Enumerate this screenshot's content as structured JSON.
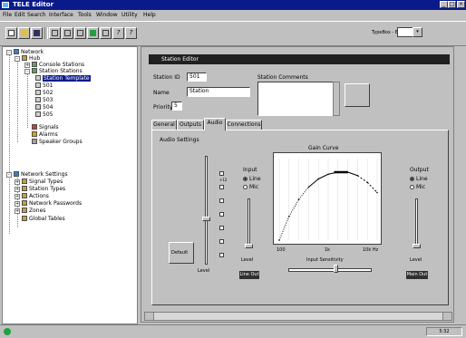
{
  "window": {
    "title": "TELE Editor"
  },
  "menu": [
    "File",
    "Edit",
    "Search",
    "Interface",
    "Tools",
    "Window",
    "Utility",
    "Help"
  ],
  "toolbar": {
    "type_label": "TypeBox - EE",
    "buttons": [
      "new",
      "open",
      "save",
      "cut",
      "copy",
      "paste",
      "props",
      "settings",
      "help",
      "info"
    ]
  },
  "tree": {
    "items": [
      {
        "label": "Network",
        "level": 0
      },
      {
        "label": "Hub",
        "level": 1
      },
      {
        "label": "Console Stations",
        "level": 2
      },
      {
        "label": "Station Stations",
        "level": 2
      },
      {
        "label": "Station Template",
        "level": 3,
        "selected": true
      },
      {
        "label": "501",
        "level": 3
      },
      {
        "label": "502",
        "level": 3
      },
      {
        "label": "503",
        "level": 3
      },
      {
        "label": "504",
        "level": 3
      },
      {
        "label": "505",
        "level": 3
      },
      {
        "label": "Signals",
        "level": 2
      },
      {
        "label": "Alarms",
        "level": 2
      },
      {
        "label": "Speaker Groups",
        "level": 2
      },
      {
        "label": "Network Settings",
        "level": 1
      },
      {
        "label": "Signal Types",
        "level": 2
      },
      {
        "label": "Station Types",
        "level": 2
      },
      {
        "label": "Actions",
        "level": 2
      },
      {
        "label": "Network Passwords",
        "level": 2
      },
      {
        "label": "Zones",
        "level": 2
      },
      {
        "label": "Global Tables",
        "level": 2
      }
    ]
  },
  "form": {
    "header": "Station Editor",
    "number_label": "Station ID",
    "number_value": "501",
    "name_label": "Name",
    "name_value": "Station",
    "priority_label": "Priority",
    "priority_value": "5",
    "comments_label": "Station Comments",
    "tabs": [
      "General",
      "Outputs",
      "Audio",
      "Connections"
    ],
    "active_tab": "Audio",
    "group_label": "Audio Settings",
    "left_section": {
      "label": "Input",
      "opt1": "Line",
      "opt2": "Mic",
      "scale": [
        "+12",
        "+6",
        "0",
        "-6",
        "-12",
        "-18",
        "-24"
      ],
      "button": "Default",
      "level_label": "Level",
      "bottom_label": "Line Out"
    },
    "chart_section": {
      "title": "Gain Curve",
      "x_ticks": [
        "100",
        "1k",
        "10k Hz"
      ],
      "slider_label": "Input Sensitivity",
      "right_label": "Output",
      "opt1": "Line",
      "opt2": "Mic",
      "level_label": "Level",
      "bottom_label": "Main Out"
    }
  },
  "chart_data": {
    "type": "line",
    "title": "Gain Curve",
    "x": [
      0,
      1,
      2,
      3,
      4,
      5,
      6,
      7,
      8,
      9,
      10
    ],
    "y": [
      0.0,
      0.35,
      0.6,
      0.78,
      0.9,
      0.97,
      1.0,
      1.0,
      0.95,
      0.85,
      0.7
    ],
    "xlim": [
      0,
      10
    ],
    "ylim": [
      0,
      1.2
    ]
  },
  "status": {
    "right_text": "5:32"
  }
}
